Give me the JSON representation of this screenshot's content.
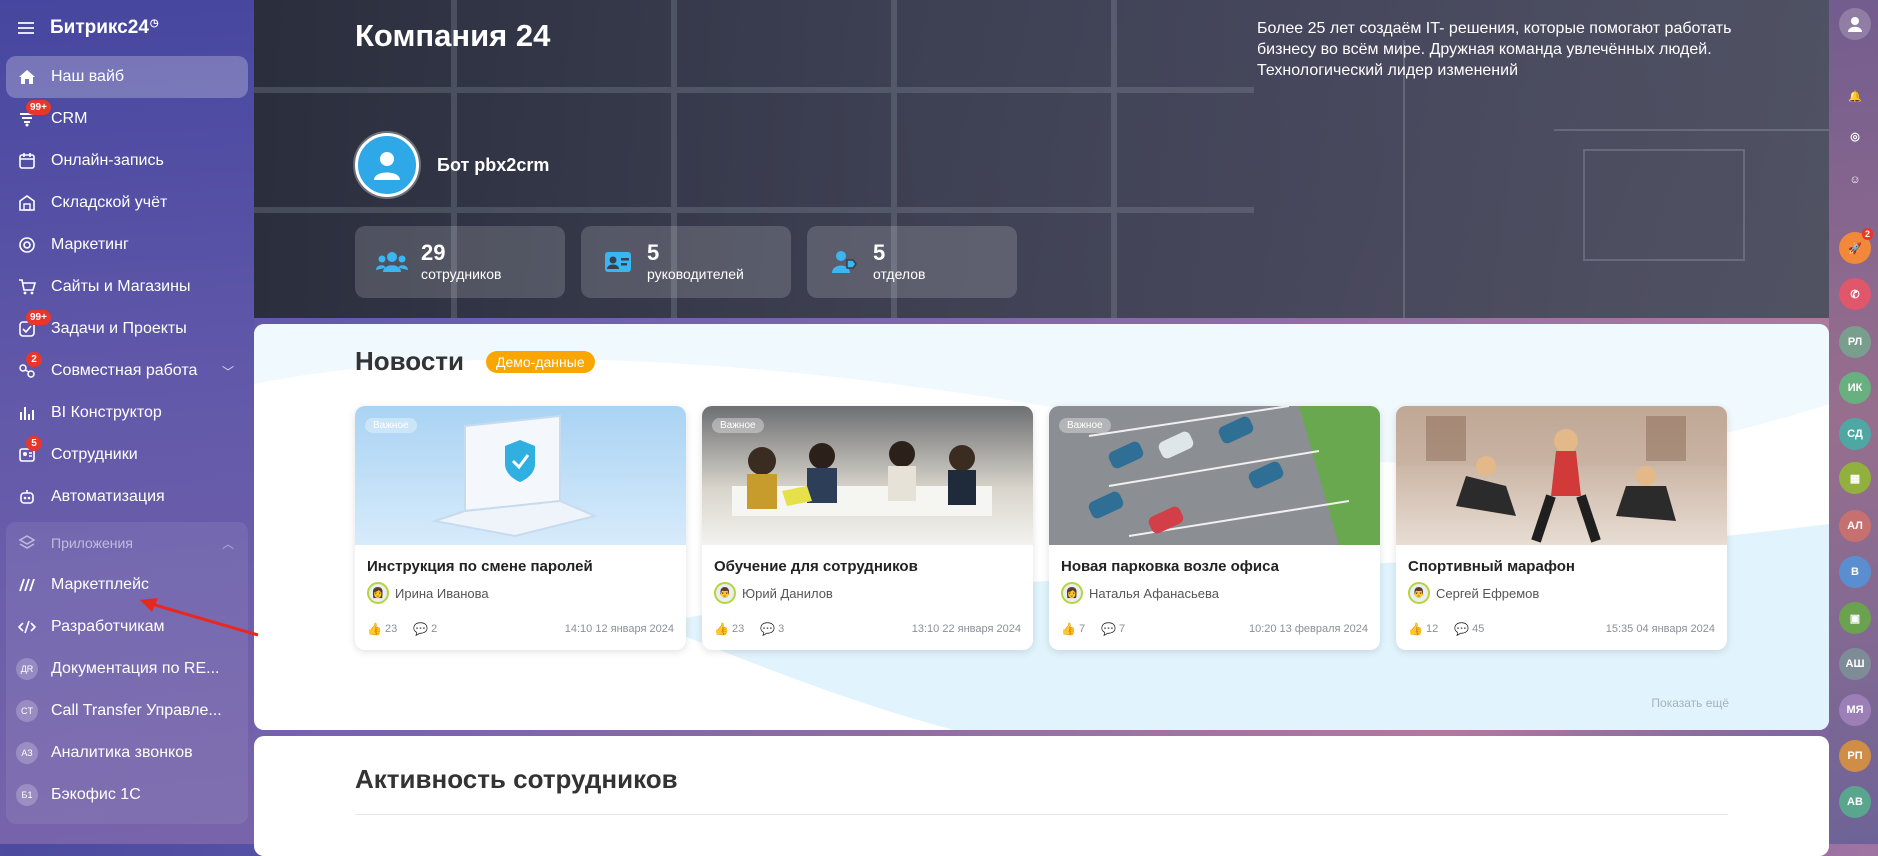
{
  "sidebar": {
    "logo": "Битрикс24",
    "items": [
      {
        "label": "Наш вайб",
        "icon": "home-icon",
        "active": true,
        "badge": ""
      },
      {
        "label": "CRM",
        "icon": "crm-icon",
        "badge": "99+"
      },
      {
        "label": "Онлайн-запись",
        "icon": "calendar-icon",
        "badge": ""
      },
      {
        "label": "Складской учёт",
        "icon": "warehouse-icon",
        "badge": ""
      },
      {
        "label": "Маркетинг",
        "icon": "marketing-icon",
        "badge": ""
      },
      {
        "label": "Сайты и Магазины",
        "icon": "cart-icon",
        "badge": ""
      },
      {
        "label": "Задачи и Проекты",
        "icon": "tasks-icon",
        "badge": "99+"
      },
      {
        "label": "Совместная работа",
        "icon": "collab-icon",
        "badge": "2"
      },
      {
        "label": "BI Конструктор",
        "icon": "bi-chart-icon",
        "badge": ""
      },
      {
        "label": "Сотрудники",
        "icon": "employees-icon",
        "badge": "5"
      },
      {
        "label": "Автоматизация",
        "icon": "automation-icon",
        "badge": ""
      }
    ],
    "apps_group": {
      "label": "Приложения",
      "items": [
        {
          "label": "Маркетплейс",
          "icon": "marketplace-icon",
          "abbr": ""
        },
        {
          "label": "Разработчикам",
          "icon": "code-icon",
          "abbr": ""
        },
        {
          "label": "Документация по RE...",
          "icon": "",
          "abbr": "ДR"
        },
        {
          "label": "Call Transfer Управле...",
          "icon": "",
          "abbr": "CT"
        },
        {
          "label": "Аналитика звонков",
          "icon": "",
          "abbr": "АЗ"
        },
        {
          "label": "Бэкофис 1С",
          "icon": "",
          "abbr": "Б1"
        }
      ]
    }
  },
  "hero": {
    "title": "Компания 24",
    "description": "Более 25 лет создаём IT- решения, которые помогают работать бизнесу во всём мире. Дружная команда увлечённых людей. Технологический лидер изменений",
    "bot_name": "Бот pbx2crm",
    "stats": [
      {
        "value": "29",
        "label": "сотрудников",
        "icon": "users-group-icon"
      },
      {
        "value": "5",
        "label": "руководителей",
        "icon": "id-card-icon"
      },
      {
        "value": "5",
        "label": "отделов",
        "icon": "department-icon"
      }
    ]
  },
  "news": {
    "title": "Новости",
    "demo_tag": "Демо-данные",
    "show_more": "Показать ещё",
    "cards": [
      {
        "tag": "Важное",
        "title": "Инструкция по смене паролей",
        "author": "Ирина Иванова",
        "likes": "23",
        "comments": "2",
        "time": "14:10 12 января 2024"
      },
      {
        "tag": "Важное",
        "title": "Обучение для сотрудников",
        "author": "Юрий Данилов",
        "likes": "23",
        "comments": "3",
        "time": "13:10 22 января 2024"
      },
      {
        "tag": "Важное",
        "title": "Новая парковка возле офиса",
        "author": "Наталья Афанасьева",
        "likes": "7",
        "comments": "7",
        "time": "10:20 13 февраля 2024"
      },
      {
        "tag": "",
        "title": "Спортивный марафон",
        "author": "Сергей Ефремов",
        "likes": "12",
        "comments": "45",
        "time": "15:35 04 января 2024"
      }
    ]
  },
  "activity": {
    "title": "Активность сотрудников"
  },
  "right_rail": {
    "items": [
      "РЛ",
      "ИК",
      "СД",
      "АЛ",
      "В",
      "АШ",
      "МЯ",
      "РП",
      "АВ"
    ],
    "notif_badge": "2"
  },
  "colors": {
    "accent": "#2fa8e8",
    "badge": "#e8362a",
    "demo_tag": "#f9a602"
  }
}
